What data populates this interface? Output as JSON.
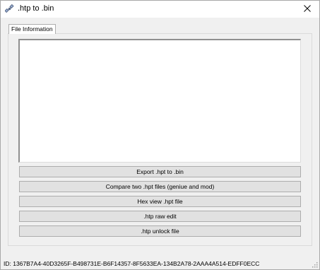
{
  "window": {
    "title": ".htp to .bin",
    "icon": "satellite-icon"
  },
  "tabs": [
    {
      "label": "File Information",
      "selected": true
    }
  ],
  "info_box": {
    "content": ""
  },
  "buttons": [
    {
      "label": "Export .hpt to .bin"
    },
    {
      "label": "Compare two .hpt files (geniue and mod)"
    },
    {
      "label": "Hex view .hpt file"
    },
    {
      "label": ".htp raw edit"
    },
    {
      "label": ".htp unlock file"
    }
  ],
  "status": {
    "id_text": "ID:  1367B7A4-40D3265F-B498731E-B6F14357-8F5633EA-134B2A78-2AAA4A514-EDFF0ECC"
  },
  "colors": {
    "window_bg": "#f0f0f0",
    "titlebar_bg": "#ffffff",
    "button_bg": "#e1e1e1",
    "button_border": "#adadad"
  }
}
